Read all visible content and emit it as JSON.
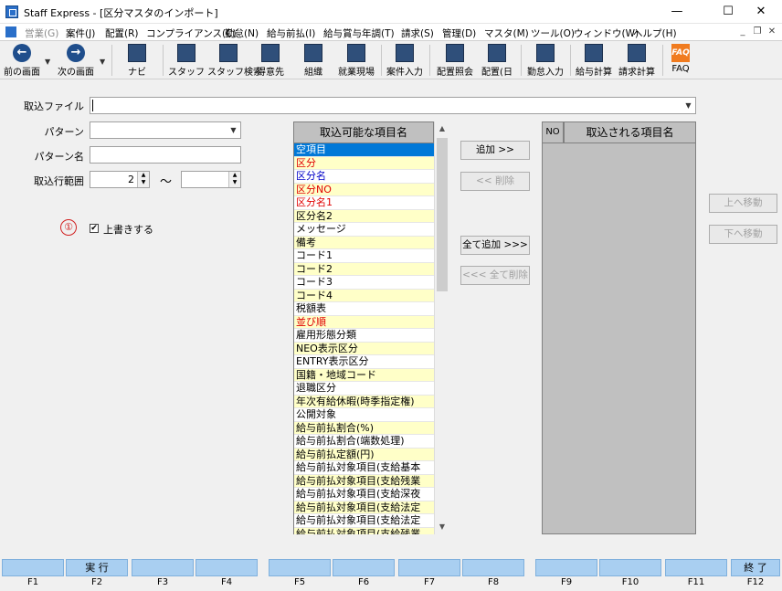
{
  "window": {
    "title": "Staff Express - [区分マスタのインポート]",
    "min": "—",
    "max": "☐",
    "close": "✕"
  },
  "menu": [
    {
      "label": "営業(G)",
      "disabled": true
    },
    {
      "label": "案件(J)"
    },
    {
      "label": "配置(R)"
    },
    {
      "label": "コンプライアンス(C)"
    },
    {
      "label": "勤怠(N)"
    },
    {
      "label": "給与前払(I)"
    },
    {
      "label": "給与賞与年調(T)"
    },
    {
      "label": "請求(S)"
    },
    {
      "label": "管理(D)"
    },
    {
      "label": "マスタ(M)"
    },
    {
      "label": "ツール(O)"
    },
    {
      "label": "ウィンドウ(W)"
    },
    {
      "label": "ヘルプ(H)"
    }
  ],
  "mdi": {
    "min": "_",
    "restore": "❐",
    "close": "✕"
  },
  "toolbar": {
    "prev": "前の画面",
    "next": "次の画面",
    "nav": "ナビ",
    "staff": "スタッフ",
    "staff_search": "スタッフ検索",
    "client": "得意先",
    "org": "組織",
    "site": "就業現場",
    "job_entry": "案件入力",
    "assign_inquiry": "配置照会",
    "assign_day": "配置(日",
    "attendance": "勤怠入力",
    "payroll": "給与計算",
    "billing": "請求計算",
    "faq": "FAQ",
    "faq_icon_text": "FAQ"
  },
  "form": {
    "import_file_label": "取込ファイル",
    "import_file_value": "",
    "pattern_label": "パターン",
    "pattern_value": "",
    "pattern_name_label": "パターン名",
    "pattern_name_value": "",
    "row_range_label": "取込行範囲",
    "row_from": "2",
    "row_to": "",
    "tilde": "～",
    "annotation_number": "①",
    "overwrite_label": "上書きする",
    "overwrite_checked": "✔"
  },
  "available": {
    "header": "取込可能な項目名",
    "items": [
      {
        "label": "空項目",
        "style": "sel"
      },
      {
        "label": "区分",
        "style": "red"
      },
      {
        "label": "区分名",
        "style": "blue"
      },
      {
        "label": "区分NO",
        "style": "red"
      },
      {
        "label": "区分名1",
        "style": "red"
      },
      {
        "label": "区分名2",
        "style": ""
      },
      {
        "label": "メッセージ",
        "style": ""
      },
      {
        "label": "備考",
        "style": ""
      },
      {
        "label": "コード1",
        "style": ""
      },
      {
        "label": "コード2",
        "style": ""
      },
      {
        "label": "コード3",
        "style": ""
      },
      {
        "label": "コード4",
        "style": ""
      },
      {
        "label": "税額表",
        "style": ""
      },
      {
        "label": "並び順",
        "style": "red"
      },
      {
        "label": "雇用形態分類",
        "style": ""
      },
      {
        "label": "NEO表示区分",
        "style": ""
      },
      {
        "label": "ENTRY表示区分",
        "style": ""
      },
      {
        "label": "国籍・地域コード",
        "style": ""
      },
      {
        "label": "退職区分",
        "style": ""
      },
      {
        "label": "年次有給休暇(時季指定権)",
        "style": ""
      },
      {
        "label": "公開対象",
        "style": ""
      },
      {
        "label": "給与前払割合(%)",
        "style": ""
      },
      {
        "label": "給与前払割合(端数処理)",
        "style": ""
      },
      {
        "label": "給与前払定額(円)",
        "style": ""
      },
      {
        "label": "給与前払対象項目(支給基本",
        "style": ""
      },
      {
        "label": "給与前払対象項目(支給残業",
        "style": ""
      },
      {
        "label": "給与前払対象項目(支給深夜",
        "style": ""
      },
      {
        "label": "給与前払対象項目(支給法定",
        "style": ""
      },
      {
        "label": "給与前払対象項目(支給法定",
        "style": ""
      },
      {
        "label": "給与前払対象項目(支給残業",
        "style": ""
      }
    ]
  },
  "buttons": {
    "add": "追加 >>",
    "remove": "<< 削除",
    "add_all": "全て追加 >>>",
    "remove_all": "<<< 全て削除",
    "move_up": "上へ移動",
    "move_down": "下へ移動"
  },
  "target": {
    "no_header": "NO",
    "header": "取込される項目名"
  },
  "fkeys": [
    {
      "key": "F1",
      "label": ""
    },
    {
      "key": "F2",
      "label": "実 行"
    },
    {
      "key": "F3",
      "label": ""
    },
    {
      "key": "F4",
      "label": ""
    },
    {
      "key": "F5",
      "label": ""
    },
    {
      "key": "F6",
      "label": ""
    },
    {
      "key": "F7",
      "label": ""
    },
    {
      "key": "F8",
      "label": ""
    },
    {
      "key": "F9",
      "label": ""
    },
    {
      "key": "F10",
      "label": ""
    },
    {
      "key": "F11",
      "label": ""
    },
    {
      "key": "F12",
      "label": "終 了"
    }
  ]
}
